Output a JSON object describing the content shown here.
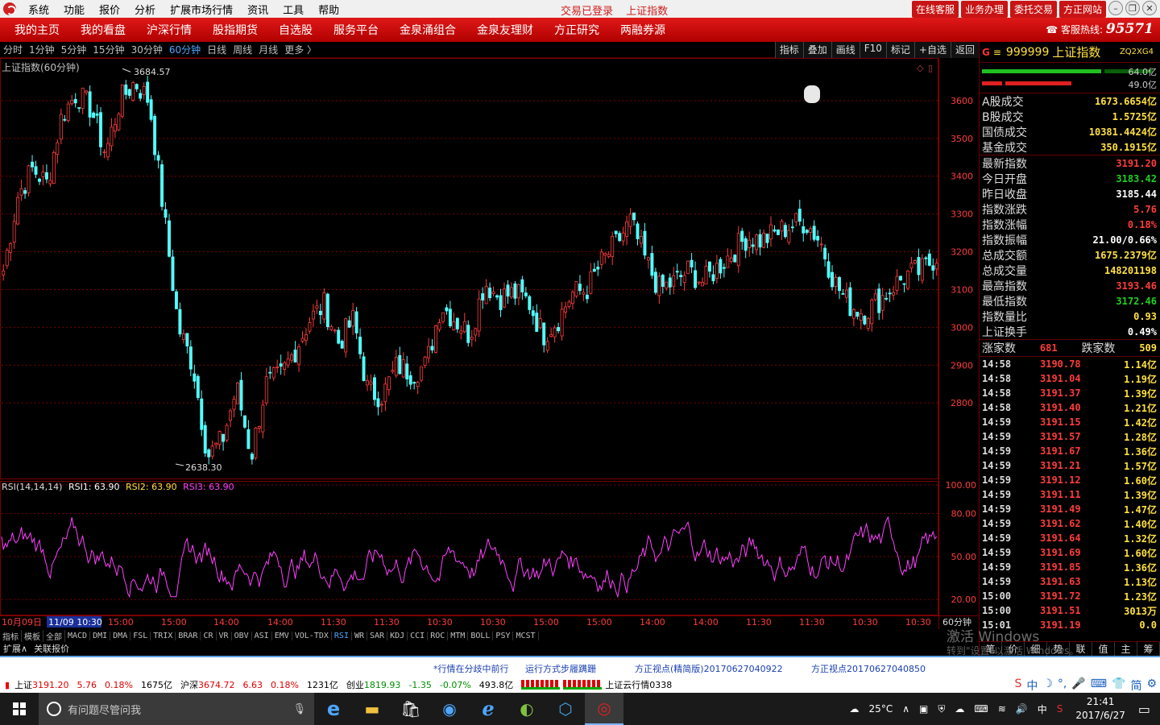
{
  "menu": [
    "系统",
    "功能",
    "报价",
    "分析",
    "扩展市场行情",
    "资讯",
    "工具",
    "帮助"
  ],
  "title_center": [
    "交易已登录",
    "上证指数"
  ],
  "top_buttons": [
    "在线客服",
    "业务办理",
    "委托交易",
    "方正网站"
  ],
  "window_controls": [
    "minimize-icon",
    "restore-icon",
    "close-icon"
  ],
  "nav": [
    "我的主页",
    "我的看盘",
    "沪深行情",
    "股指期货",
    "自选股",
    "服务平台",
    "金泉涌组合",
    "金泉友理财",
    "方正研究",
    "两融券源"
  ],
  "hotline": {
    "label": "客服热线:",
    "number": "95571"
  },
  "periods": [
    "分时",
    "1分钟",
    "5分钟",
    "15分钟",
    "30分钟",
    "60分钟",
    "日线",
    "周线",
    "月线",
    "更多 〉"
  ],
  "active_period": "60分钟",
  "tools": [
    "指标",
    "叠加",
    "画线",
    "F10",
    "标记",
    "+自选",
    "返回"
  ],
  "chart": {
    "title": "上证指数(60分钟)",
    "high_label": "3684.57",
    "low_label": "2638.30",
    "price_ticks": [
      "3600",
      "3500",
      "3400",
      "3300",
      "3200",
      "3100",
      "3000",
      "2900",
      "2800"
    ],
    "rsi_title": "RSI(14,14,14)",
    "rsi1": "RSI1: 63.90",
    "rsi2": "RSI2: 63.90",
    "rsi3": "RSI3: 63.90",
    "rsi_ticks": [
      "100.00",
      "80.00",
      "50.00",
      "20.00"
    ],
    "time_labels": [
      "10月09日",
      "11/09 10:30",
      "15:00",
      "15:00",
      "14:00",
      "14:00",
      "11:30",
      "11:30",
      "10:30",
      "10:30",
      "15:00",
      "15:00",
      "14:00",
      "14:00",
      "11:30",
      "11:30",
      "10:30",
      "10:30"
    ],
    "period_label": "60分钟",
    "colors": {
      "up": "#ff3c3c",
      "down": "#52ffff",
      "rsi": "#ff40ff",
      "grid": "#7a0000"
    }
  },
  "chart_data": {
    "type": "candlestick",
    "title": "上证指数(60分钟)",
    "y_range": [
      2600,
      3700
    ],
    "high": 3684.57,
    "low": 2638.3,
    "close_path": [
      3150,
      3350,
      3420,
      3380,
      3560,
      3620,
      3580,
      3460,
      3600,
      3650,
      3600,
      3300,
      3000,
      2900,
      2660,
      2700,
      2840,
      2660,
      2850,
      2870,
      2940,
      3020,
      3060,
      2960,
      3020,
      2830,
      2820,
      2900,
      2880,
      2900,
      3060,
      3020,
      2980,
      3120,
      3080,
      3090,
      3070,
      2980,
      3020,
      3090,
      3100,
      3170,
      3220,
      3280,
      3180,
      3100,
      3120,
      3150,
      3120,
      3160,
      3200,
      3240,
      3230,
      3250,
      3270,
      3280,
      3230,
      3120,
      3060,
      3040,
      3070,
      3110,
      3140,
      3150,
      3190
    ],
    "rsi_range": [
      0,
      100
    ],
    "rsi_last": 63.9
  },
  "right_panel": {
    "code": "999999",
    "name": "上证指数",
    "zq": "ZQ2XG4",
    "bar1": "64.0亿",
    "bar2": "49.0亿",
    "volumes": [
      {
        "label": "A股成交",
        "value": "1673.6654亿"
      },
      {
        "label": "B股成交",
        "value": "1.5725亿"
      },
      {
        "label": "国债成交",
        "value": "10381.4424亿"
      },
      {
        "label": "基金成交",
        "value": "350.1915亿"
      }
    ],
    "stats": [
      {
        "label": "最新指数",
        "value": "3191.20",
        "c": "r"
      },
      {
        "label": "今日开盘",
        "value": "3183.42",
        "c": "gr"
      },
      {
        "label": "昨日收盘",
        "value": "3185.44",
        "c": "w"
      },
      {
        "label": "指数涨跌",
        "value": "5.76",
        "c": "r"
      },
      {
        "label": "指数涨幅",
        "value": "0.18%",
        "c": "r"
      },
      {
        "label": "指数振幅",
        "value": "21.00/0.66%",
        "c": "w"
      },
      {
        "label": "总成交额",
        "value": "1675.2379亿",
        "c": "y"
      },
      {
        "label": "总成交量",
        "value": "148201198",
        "c": "y"
      },
      {
        "label": "最高指数",
        "value": "3193.46",
        "c": "r"
      },
      {
        "label": "最低指数",
        "value": "3172.46",
        "c": "gr"
      },
      {
        "label": "指数量比",
        "value": "0.93",
        "c": "y"
      },
      {
        "label": "上证换手",
        "value": "0.49%",
        "c": "w"
      }
    ],
    "rise_label": "涨家数",
    "rise": "681",
    "fall_label": "跌家数",
    "fall": "509",
    "ticks": [
      {
        "t": "14:58",
        "p": "3190.78",
        "a": "1.14亿"
      },
      {
        "t": "14:58",
        "p": "3191.04",
        "a": "1.19亿"
      },
      {
        "t": "14:58",
        "p": "3191.37",
        "a": "1.39亿"
      },
      {
        "t": "14:58",
        "p": "3191.40",
        "a": "1.21亿"
      },
      {
        "t": "14:59",
        "p": "3191.15",
        "a": "1.42亿"
      },
      {
        "t": "14:59",
        "p": "3191.57",
        "a": "1.28亿"
      },
      {
        "t": "14:59",
        "p": "3191.67",
        "a": "1.36亿"
      },
      {
        "t": "14:59",
        "p": "3191.21",
        "a": "1.57亿"
      },
      {
        "t": "14:59",
        "p": "3191.12",
        "a": "1.60亿"
      },
      {
        "t": "14:59",
        "p": "3191.11",
        "a": "1.39亿"
      },
      {
        "t": "14:59",
        "p": "3191.49",
        "a": "1.47亿"
      },
      {
        "t": "14:59",
        "p": "3191.62",
        "a": "1.40亿"
      },
      {
        "t": "14:59",
        "p": "3191.64",
        "a": "1.32亿"
      },
      {
        "t": "14:59",
        "p": "3191.69",
        "a": "1.60亿"
      },
      {
        "t": "14:59",
        "p": "3191.85",
        "a": "1.36亿"
      },
      {
        "t": "14:59",
        "p": "3191.63",
        "a": "1.13亿"
      },
      {
        "t": "15:00",
        "p": "3191.72",
        "a": "1.23亿"
      },
      {
        "t": "15:00",
        "p": "3191.51",
        "a": "3013万"
      },
      {
        "t": "15:01",
        "p": "3191.19",
        "a": "0.0"
      }
    ],
    "bottom_tabs": [
      "笔",
      "价",
      "细",
      "势",
      "联",
      "值",
      "主",
      "筹"
    ]
  },
  "indicators": [
    "指标",
    "模板",
    "全部",
    "MACD",
    "DMI",
    "DMA",
    "FSL",
    "TRIX",
    "BRAR",
    "CR",
    "VR",
    "OBV",
    "ASI",
    "EMV",
    "VOL-TDX",
    "RSI",
    "WR",
    "SAR",
    "KDJ",
    "CCI",
    "ROC",
    "MTM",
    "BOLL",
    "PSY",
    "MCST"
  ],
  "active_indicator": "RSI",
  "subtabs": [
    "扩展∧",
    "关联报价"
  ],
  "watermark": {
    "line1": "激活 Windows",
    "line2": "转到\"设置\"以激活 Windows。"
  },
  "news": [
    "*行情在分歧中前行",
    "运行方式步履蹒跚",
    "方正视点(精简版)20170627040922",
    "方正视点20170627040850"
  ],
  "quotes": {
    "sh_label": "上证",
    "sh_val": "3191.20",
    "sh_chg": "5.76",
    "sh_pct": "0.18%",
    "sh_amt": "1675亿",
    "hs_label": "沪深",
    "hs_val": "3674.72",
    "hs_chg": "6.63",
    "hs_pct": "0.18%",
    "hs_amt": "1231亿",
    "cy_label": "创业",
    "cy_val": "1819.93",
    "cy_chg": "-1.35",
    "cy_pct": "-0.07%",
    "cy_amt": "493.8亿",
    "cloud": "上证云行情0338"
  },
  "taskbar": {
    "search_placeholder": "有问题尽管问我",
    "temp": "25°C",
    "ime": "中",
    "time": "21:41",
    "date": "2017/6/27"
  }
}
